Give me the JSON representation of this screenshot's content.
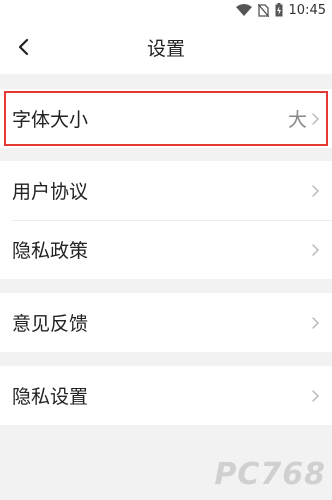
{
  "status_bar": {
    "time": "10:45",
    "icons": [
      "wifi-icon",
      "no-sim-icon",
      "battery-charging-icon"
    ]
  },
  "header": {
    "back_icon": "chevron-left-icon",
    "title": "设置"
  },
  "groups": [
    {
      "items": [
        {
          "label": "字体大小",
          "value": "大",
          "highlighted": true
        }
      ]
    },
    {
      "items": [
        {
          "label": "用户协议"
        },
        {
          "label": "隐私政策"
        }
      ]
    },
    {
      "items": [
        {
          "label": "意见反馈"
        }
      ]
    },
    {
      "items": [
        {
          "label": "隐私设置"
        }
      ]
    }
  ],
  "watermark": "PC768",
  "colors": {
    "background": "#f2f2f2",
    "card": "#ffffff",
    "highlight_border": "#e53935",
    "chevron": "#bbbbbb"
  }
}
